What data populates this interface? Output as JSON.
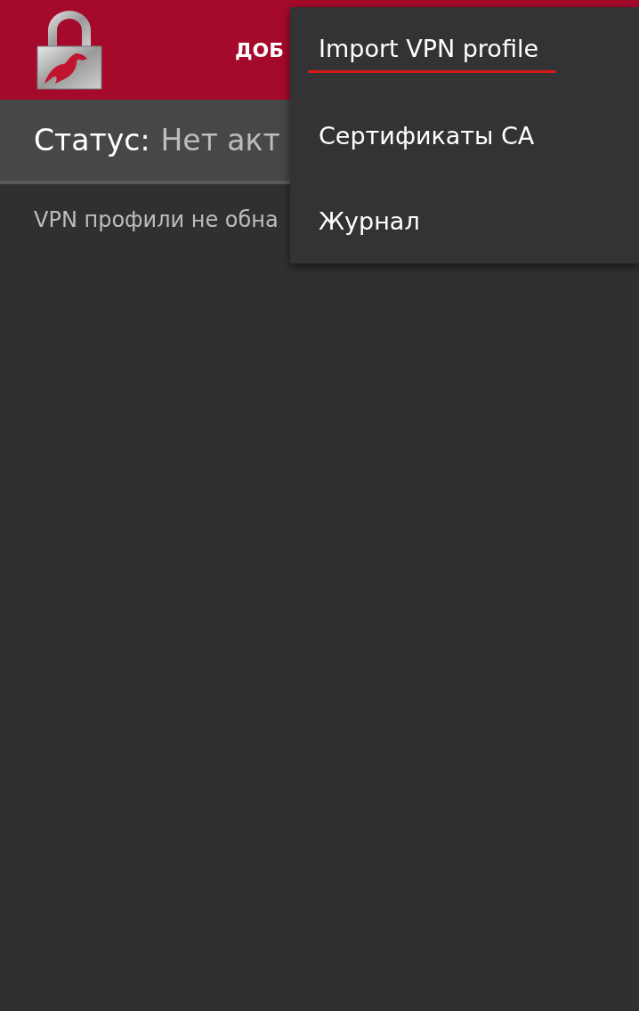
{
  "toolbar": {
    "action": "ДОБ"
  },
  "status": {
    "label": "Статус:",
    "value": "Нет акт"
  },
  "empty_message": "VPN профили не обна",
  "menu": {
    "items": [
      {
        "label": "Import VPN profile",
        "selected": true
      },
      {
        "label": "Сертификаты CA",
        "selected": false
      },
      {
        "label": "Журнал",
        "selected": false
      }
    ]
  }
}
